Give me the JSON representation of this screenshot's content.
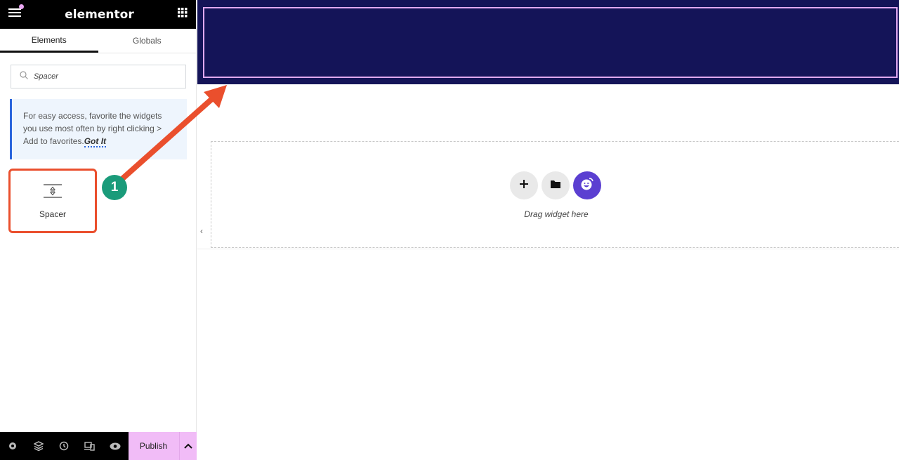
{
  "header": {
    "logo": "elementor",
    "menu_icon": "hamburger-icon",
    "apps_icon": "grid-icon"
  },
  "tabs": [
    {
      "label": "Elements",
      "active": true
    },
    {
      "label": "Globals",
      "active": false
    }
  ],
  "search": {
    "value": "Spacer",
    "placeholder": "Search Widget..."
  },
  "notice": {
    "text": "For easy access, favorite the widgets you use most often by right clicking > Add to favorites.",
    "link": "Got It"
  },
  "widgets": [
    {
      "label": "Spacer",
      "icon": "spacer-icon"
    }
  ],
  "footer": {
    "icons": [
      "settings-icon",
      "layers-icon",
      "history-icon",
      "responsive-icon",
      "eye-icon"
    ],
    "publish_label": "Publish"
  },
  "canvas": {
    "drag_text": "Drag widget here",
    "banner_color": "#141458"
  },
  "annotation": {
    "step": "1",
    "color": "#ea4f2d",
    "badge_color": "#1a9b7a"
  }
}
